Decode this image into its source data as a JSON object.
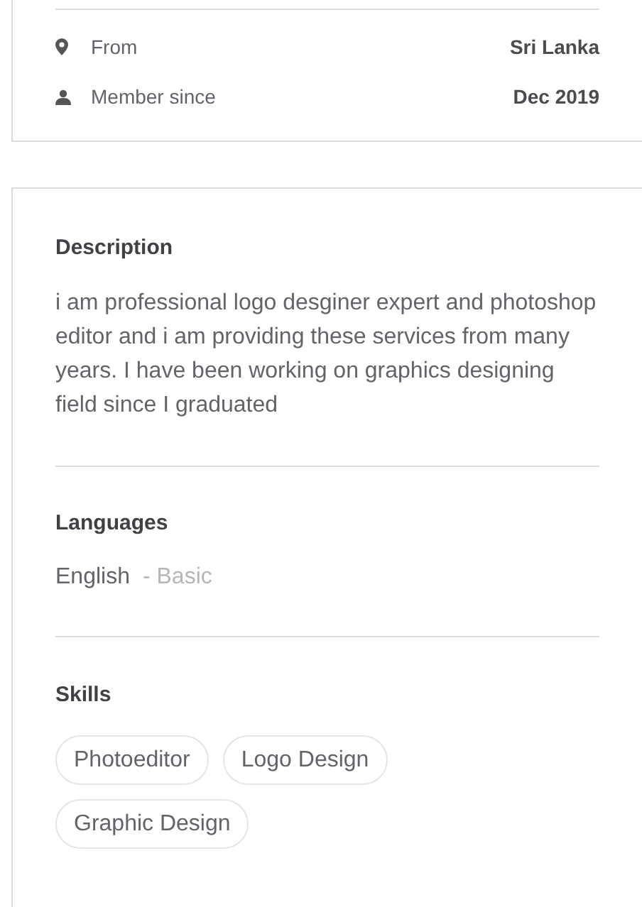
{
  "info_rows": [
    {
      "kind": "location",
      "label": "From",
      "value": "Sri Lanka"
    },
    {
      "kind": "member",
      "label": "Member since",
      "value": "Dec 2019"
    }
  ],
  "description": {
    "heading": "Description",
    "text": "i am professional logo desginer expert and photoshop editor and i am providing these services from many years. I have been working on graphics designing field since I graduated"
  },
  "languages": {
    "heading": "Languages",
    "items": [
      {
        "name": "English",
        "level": "- Basic"
      }
    ]
  },
  "skills": {
    "heading": "Skills",
    "items": [
      "Photoeditor",
      "Logo Design",
      "Graphic Design"
    ]
  }
}
